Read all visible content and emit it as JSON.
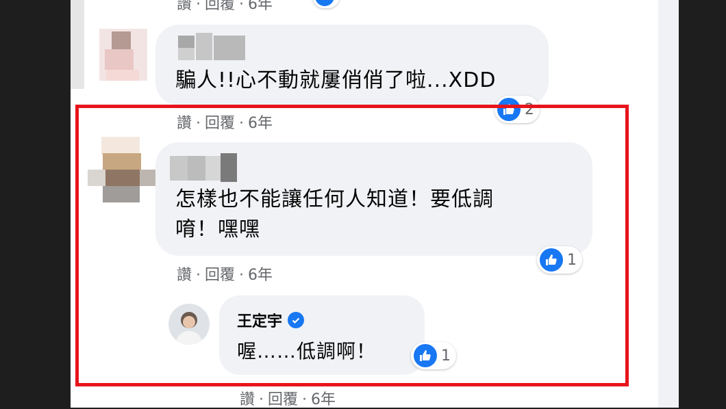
{
  "comments": [
    {
      "text_lines": [
        "騙人!!心不動就屢俏俏了啦...XDD"
      ],
      "meta": {
        "like": "讚",
        "reply": "回覆",
        "time": "6年"
      },
      "reaction_count": "2"
    },
    {
      "text_lines": [
        "怎樣也不能讓任何人知道！要低調",
        "唷！嘿嘿"
      ],
      "meta": {
        "like": "讚",
        "reply": "回覆",
        "time": "6年"
      },
      "reaction_count": "1"
    }
  ],
  "top_meta": {
    "like": "讚",
    "reply": "回覆",
    "time": "6年"
  },
  "reply": {
    "author": "王定宇",
    "text": "喔……低調啊！",
    "reaction_count": "1",
    "meta": {
      "like": "讚",
      "reply": "回覆",
      "time": "6年"
    }
  },
  "colors": {
    "highlight": "#e8141b",
    "like_blue": "#1877f2",
    "bubble": "#f0f2f5",
    "meta_gray": "#65676b"
  },
  "icons": [
    "like-icon",
    "verified-badge-icon"
  ]
}
